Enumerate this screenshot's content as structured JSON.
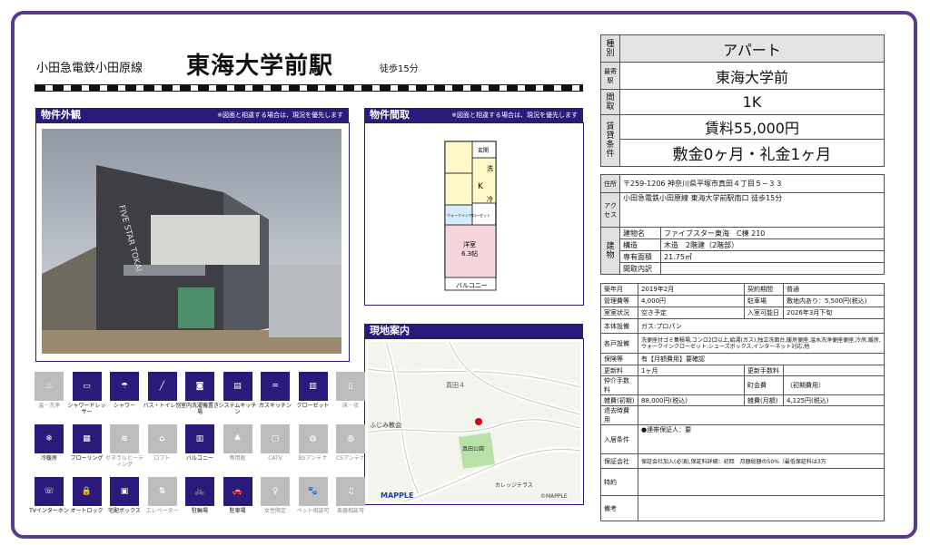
{
  "header": {
    "line": "小田急電鉄小田原線",
    "station": "東海大学前駅",
    "walk": "徒歩15分"
  },
  "panels": {
    "exterior": {
      "title": "物件外観",
      "note": "※図面と相違する場合は、現況を優先します"
    },
    "floorplan": {
      "title": "物件間取",
      "note": "※図面と相違する場合は、現況を優先します",
      "rooms": {
        "laundry": "洗",
        "kitchen": "K",
        "fridge": "冷",
        "closet": "ウォークインクローゼット",
        "room": "洋室",
        "size": "6.3帖",
        "balcony": "バルコニー",
        "entry": "玄関"
      }
    },
    "map": {
      "title": "現地案内",
      "labels": {
        "area": "真田４",
        "church": "ふじみ教会",
        "park": "真田公園",
        "terrace": "カレッジテラス",
        "brand": "MAPPLE",
        "copy": "©MAPPLE"
      }
    }
  },
  "building_photo": {
    "sign": "FIVE STAR TOKAI"
  },
  "amenities": [
    {
      "label": "温・洗浄",
      "on": false,
      "glyph": "♨"
    },
    {
      "label": "シャワードレッサー",
      "on": true,
      "glyph": "▭"
    },
    {
      "label": "シャワー",
      "on": true,
      "glyph": "☂"
    },
    {
      "label": "バス・トイレ別",
      "on": true,
      "glyph": "╱"
    },
    {
      "label": "室内洗濯機置き場",
      "on": true,
      "glyph": "◙"
    },
    {
      "label": "システムキッチン",
      "on": true,
      "glyph": "▤"
    },
    {
      "label": "ガスキッチン",
      "on": true,
      "glyph": "♒"
    },
    {
      "label": "クローゼット",
      "on": true,
      "glyph": "▥"
    },
    {
      "label": "床・収",
      "on": false,
      "glyph": "▯"
    },
    {
      "label": "冷暖房",
      "on": true,
      "glyph": "❄"
    },
    {
      "label": "フローリング",
      "on": true,
      "glyph": "▦"
    },
    {
      "label": "ゼネラルヒーティング",
      "on": false,
      "glyph": "≋"
    },
    {
      "label": "ロフト",
      "on": false,
      "glyph": "⌂"
    },
    {
      "label": "バルコニー",
      "on": true,
      "glyph": "▥"
    },
    {
      "label": "専用庭",
      "on": false,
      "glyph": "♣"
    },
    {
      "label": "CATV",
      "on": false,
      "glyph": "▢"
    },
    {
      "label": "BSアンテナ",
      "on": false,
      "glyph": "◍"
    },
    {
      "label": "CSアンテナ",
      "on": false,
      "glyph": "◍"
    },
    {
      "label": "TVインターホン",
      "on": true,
      "glyph": "☏"
    },
    {
      "label": "オートロック",
      "on": true,
      "glyph": "🔒"
    },
    {
      "label": "宅配ボックス",
      "on": true,
      "glyph": "▣"
    },
    {
      "label": "エレベーター",
      "on": false,
      "glyph": "⇅"
    },
    {
      "label": "駐輪場",
      "on": true,
      "glyph": "🚲"
    },
    {
      "label": "駐車場",
      "on": true,
      "glyph": "🚗"
    },
    {
      "label": "女性限定",
      "on": false,
      "glyph": "♀"
    },
    {
      "label": "ペット相談可",
      "on": false,
      "glyph": "🐾"
    },
    {
      "label": "楽器相談可",
      "on": false,
      "glyph": "♫"
    }
  ],
  "summary": {
    "type_label": "種別",
    "type": "アパート",
    "station_label": "最寄駅",
    "station": "東海大学前",
    "layout_label": "間取",
    "layout": "1K",
    "terms_label": "賃貸条件",
    "rent": "賃料55,000円",
    "deposit": "敷金0ヶ月・礼金1ヶ月"
  },
  "info": {
    "address_label": "住所",
    "address": "〒259-1206 神奈川県平塚市真田４丁目５−３３",
    "access_label": "アクセス",
    "access": "小田急電鉄小田原線 東海大学前駅南口 徒歩15分",
    "building_label": "建物",
    "rows": [
      {
        "k": "建物名",
        "v": "ファイブスター東海　C棟 210"
      },
      {
        "k": "構造",
        "v": "木造　2階建（2階部）"
      },
      {
        "k": "専有面積",
        "v": "21.75㎡"
      },
      {
        "k": "間取内訳",
        "v": ""
      }
    ]
  },
  "details": {
    "built_label": "築年月",
    "built": "2019年2月",
    "contract_label": "契約期間",
    "contract": "普通",
    "mgmt_label": "管理費等",
    "mgmt": "4,000円",
    "parking_label": "駐車場",
    "parking": "敷地内あり：5,500円(税込)",
    "status_label": "室室状況",
    "status": "空き予定",
    "movein_label": "入室可能日",
    "movein": "2026年3月下旬",
    "equip_label": "本体設備",
    "equip": "ガス:プロパン",
    "features_label": "各戸設備",
    "features": "洗便座付ゴミ集積場,コンロ2口以上,給湯(ガス),独立洗面台,暖房便座,温水洗浄便座便座,冷房,暖房,ウォークインクローゼット,シューズボックス,インターネット対応,他",
    "insurance_label": "保険等",
    "insurance": "有【月額費用】要確認",
    "renewal_label": "更新料",
    "renewal": "1ヶ月",
    "renewal_fee_label": "更新手数料",
    "renewal_fee": "",
    "broker_label": "仲介手数料",
    "broker": "",
    "town_label": "町会費",
    "town": "（初期費用）",
    "misc_init_label": "雑費(初期)",
    "misc_init": "88,000円(税込)",
    "misc_month_label": "雑費(月額)",
    "misc_month": "4,125円(税込)",
    "refund_label": "退去時費用",
    "refund": "",
    "conditions_label": "入居条件",
    "conditions": "●連帯保証人：要",
    "guarantee_label": "保証会社",
    "guarantee": "保証会社加入(必須),保証料詳細：初回　月額総額の50%（最低保証料は3万",
    "special_label": "特約",
    "special": "",
    "remarks_label": "備考",
    "remarks": ""
  }
}
